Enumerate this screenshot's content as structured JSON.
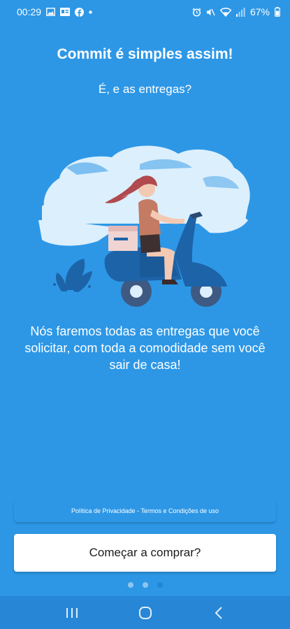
{
  "status_bar": {
    "time": "00:29",
    "battery": "67%",
    "left_icons": [
      "gallery-icon",
      "news-icon",
      "facebook-icon",
      "dot-icon"
    ],
    "right_icons": [
      "alarm-icon",
      "mute-icon",
      "wifi-icon",
      "signal-icon",
      "battery-icon"
    ]
  },
  "onboarding": {
    "title": "Commit é simples assim!",
    "subtitle": "É, e as entregas?",
    "illustration": "woman-riding-scooter-delivery",
    "description": "Nós faremos todas as entregas que você solicitar, com toda a comodidade sem você sair de casa!",
    "page_index": 3,
    "page_count": 3
  },
  "footer": {
    "privacy_link": "Política de Privacidade",
    "separator": " - ",
    "terms_link": "Termos e Condições de uso",
    "start_button": "Começar a comprar?"
  },
  "colors": {
    "background": "#2d97e6",
    "nav_bar": "#2787d6",
    "button_background": "#ffffff",
    "dot_active": "#1f86d6",
    "dot_inactive": "#8fc6ef"
  }
}
